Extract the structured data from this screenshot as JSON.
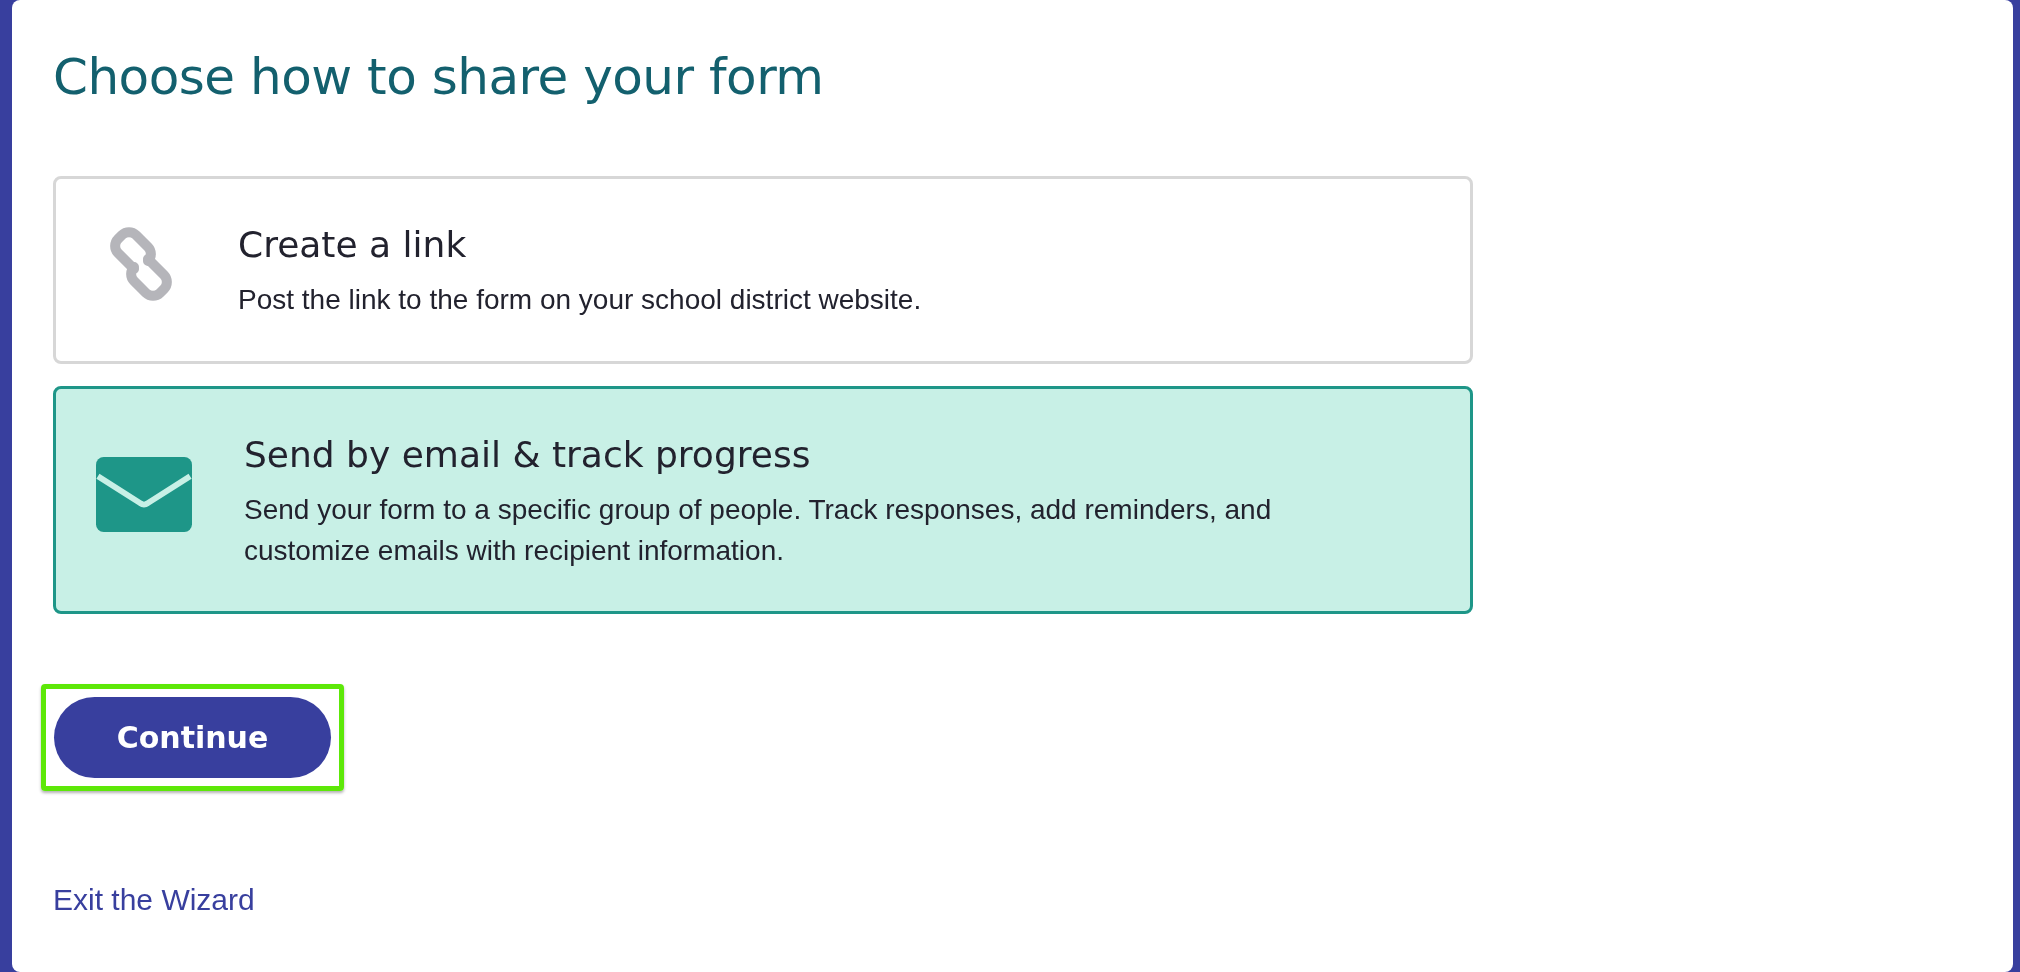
{
  "title": "Choose how to share your form",
  "options": [
    {
      "kind": "link",
      "heading": "Create a link",
      "description": "Post the link to the form on your school district website.",
      "selected": false
    },
    {
      "kind": "email",
      "heading": "Send by email & track progress",
      "description": "Send your form to a specific group of people. Track responses, add reminders, and customize emails with recipient information.",
      "selected": true
    }
  ],
  "continue_button": {
    "label": "Continue",
    "highlighted": true
  },
  "exit_link": "Exit the Wizard"
}
